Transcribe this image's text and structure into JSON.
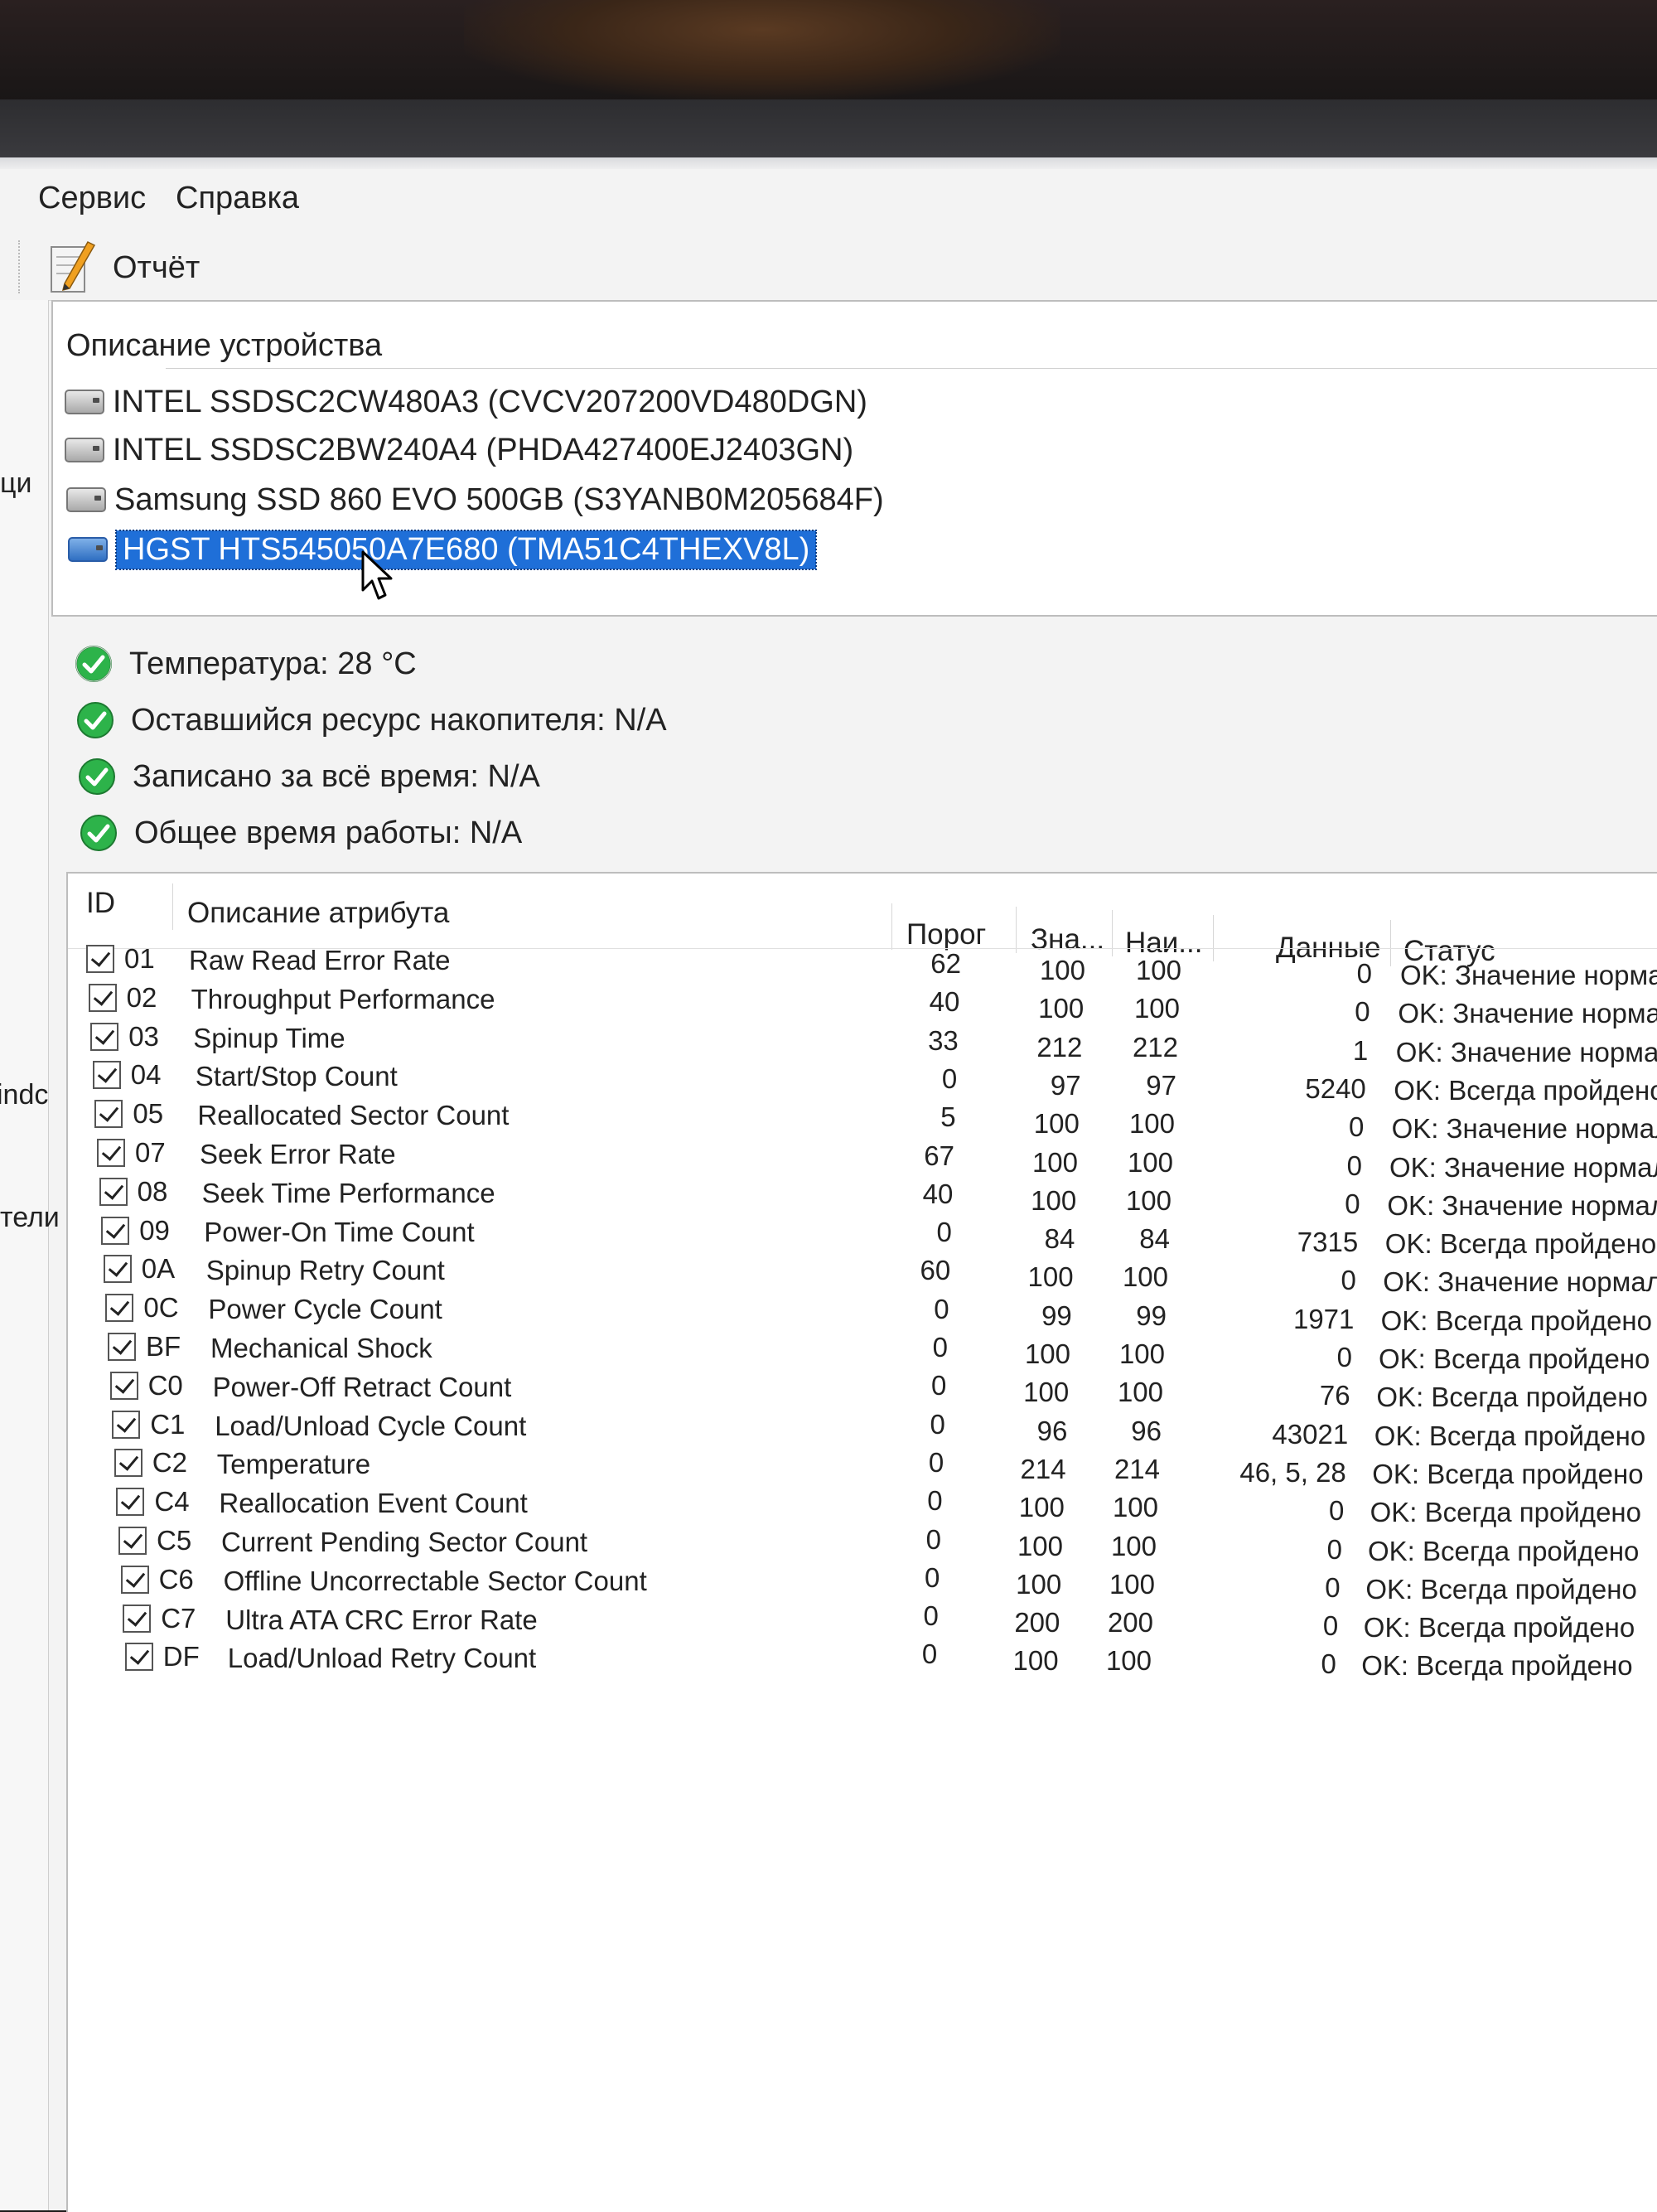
{
  "menu": {
    "items": [
      {
        "label": "Сервис"
      },
      {
        "label": "Справка"
      }
    ]
  },
  "toolbar": {
    "report_label": "Отчёт"
  },
  "left_fragments": [
    "ци",
    "indc",
    "тели"
  ],
  "device_panel": {
    "header": "Описание устройства",
    "devices": [
      {
        "label": "INTEL SSDSC2CW480A3 (CVCV207200VD480DGN)",
        "selected": false
      },
      {
        "label": "INTEL SSDSC2BW240A4 (PHDA427400EJ2403GN)",
        "selected": false
      },
      {
        "label": "Samsung SSD 860 EVO 500GB (S3YANB0M205684F)",
        "selected": false
      },
      {
        "label": "HGST HTS545050A7E680 (TMA51C4THEXV8L)",
        "selected": true
      }
    ]
  },
  "status": [
    {
      "label": "Температура: 28 °C"
    },
    {
      "label": "Оставшийся ресурс накопителя: N/A"
    },
    {
      "label": "Записано за всё время: N/A"
    },
    {
      "label": "Общее время работы: N/A"
    }
  ],
  "table": {
    "columns": {
      "id": "ID",
      "description": "Описание атрибута",
      "threshold": "Порог",
      "value": "Зна...",
      "worst": "Наи...",
      "data": "Данные",
      "status": "Статус"
    },
    "rows": [
      {
        "id": "01",
        "name": "Raw Read Error Rate",
        "threshold": "62",
        "value": "100",
        "worst": "100",
        "data": "0",
        "status": "OK: Значение норма"
      },
      {
        "id": "02",
        "name": "Throughput Performance",
        "threshold": "40",
        "value": "100",
        "worst": "100",
        "data": "0",
        "status": "OK: Значение нормал"
      },
      {
        "id": "03",
        "name": "Spinup Time",
        "threshold": "33",
        "value": "212",
        "worst": "212",
        "data": "1",
        "status": "OK: Значение нормал"
      },
      {
        "id": "04",
        "name": "Start/Stop Count",
        "threshold": "0",
        "value": "97",
        "worst": "97",
        "data": "5240",
        "status": "OK: Всегда пройдено"
      },
      {
        "id": "05",
        "name": "Reallocated Sector Count",
        "threshold": "5",
        "value": "100",
        "worst": "100",
        "data": "0",
        "status": "OK: Значение нормаль"
      },
      {
        "id": "07",
        "name": "Seek Error Rate",
        "threshold": "67",
        "value": "100",
        "worst": "100",
        "data": "0",
        "status": "OK: Значение нормаль"
      },
      {
        "id": "08",
        "name": "Seek Time Performance",
        "threshold": "40",
        "value": "100",
        "worst": "100",
        "data": "0",
        "status": "OK: Значение нормаль"
      },
      {
        "id": "09",
        "name": "Power-On Time Count",
        "threshold": "0",
        "value": "84",
        "worst": "84",
        "data": "7315",
        "status": "OK: Всегда пройдено"
      },
      {
        "id": "0A",
        "name": "Spinup Retry Count",
        "threshold": "60",
        "value": "100",
        "worst": "100",
        "data": "0",
        "status": "OK: Значение нормальн"
      },
      {
        "id": "0C",
        "name": "Power Cycle Count",
        "threshold": "0",
        "value": "99",
        "worst": "99",
        "data": "1971",
        "status": "OK: Всегда пройдено"
      },
      {
        "id": "BF",
        "name": "Mechanical Shock",
        "threshold": "0",
        "value": "100",
        "worst": "100",
        "data": "0",
        "status": "OK: Всегда пройдено"
      },
      {
        "id": "C0",
        "name": "Power-Off Retract Count",
        "threshold": "0",
        "value": "100",
        "worst": "100",
        "data": "76",
        "status": "OK: Всегда пройдено"
      },
      {
        "id": "C1",
        "name": "Load/Unload Cycle Count",
        "threshold": "0",
        "value": "96",
        "worst": "96",
        "data": "43021",
        "status": "OK: Всегда пройдено"
      },
      {
        "id": "C2",
        "name": "Temperature",
        "threshold": "0",
        "value": "214",
        "worst": "214",
        "data": "46, 5, 28",
        "status": "OK: Всегда пройдено"
      },
      {
        "id": "C4",
        "name": "Reallocation Event Count",
        "threshold": "0",
        "value": "100",
        "worst": "100",
        "data": "0",
        "status": "OK: Всегда пройдено"
      },
      {
        "id": "C5",
        "name": "Current Pending Sector Count",
        "threshold": "0",
        "value": "100",
        "worst": "100",
        "data": "0",
        "status": "OK: Всегда пройдено"
      },
      {
        "id": "C6",
        "name": "Offline Uncorrectable Sector Count",
        "threshold": "0",
        "value": "100",
        "worst": "100",
        "data": "0",
        "status": "OK: Всегда пройдено"
      },
      {
        "id": "C7",
        "name": "Ultra ATA CRC Error Rate",
        "threshold": "0",
        "value": "200",
        "worst": "200",
        "data": "0",
        "status": "OK: Всегда пройдено"
      },
      {
        "id": "DF",
        "name": "Load/Unload Retry Count",
        "threshold": "0",
        "value": "100",
        "worst": "100",
        "data": "0",
        "status": "OK: Всегда пройдено"
      }
    ]
  },
  "colors": {
    "selection": "#1f6fd8",
    "ok_green": "#2db34a",
    "window_bg": "#f3f3f3"
  },
  "icons": {
    "report": "report-notepad-icon",
    "disk": "hard-disk-icon",
    "ok": "check-circle-icon",
    "cursor": "mouse-pointer-icon"
  }
}
